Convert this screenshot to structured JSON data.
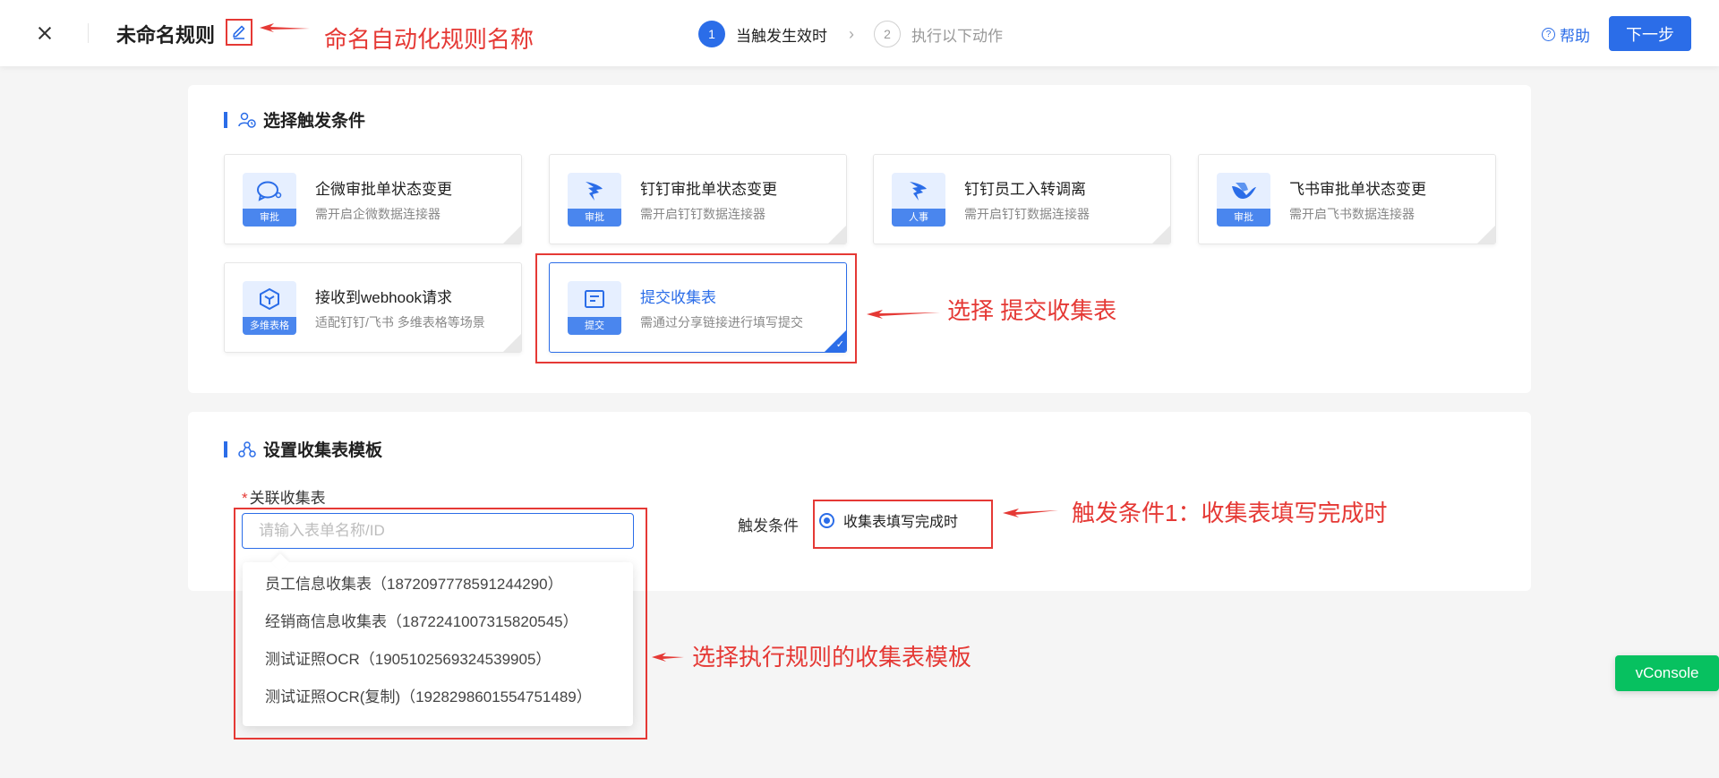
{
  "header": {
    "rule_name": "未命名规则",
    "steps": [
      {
        "num": "1",
        "label": "当触发生效时"
      },
      {
        "num": "2",
        "label": "执行以下动作"
      }
    ],
    "help_label": "帮助",
    "help_icon_glyph": "?",
    "next_label": "下一步"
  },
  "annotations": {
    "rename": "命名自动化规则名称",
    "select_form": "选择 提交收集表",
    "trigger1": "触发条件1：收集表填写完成时",
    "select_template": "选择执行规则的收集表模板"
  },
  "trigger_section": {
    "title": "选择触发条件",
    "cards": [
      {
        "title": "企微审批单状态变更",
        "desc": "需开启企微数据连接器",
        "tag": "审批",
        "icon": "wechat-work-icon"
      },
      {
        "title": "钉钉审批单状态变更",
        "desc": "需开启钉钉数据连接器",
        "tag": "审批",
        "icon": "dingtalk-icon"
      },
      {
        "title": "钉钉员工入转调离",
        "desc": "需开启钉钉数据连接器",
        "tag": "人事",
        "icon": "dingtalk-icon"
      },
      {
        "title": "飞书审批单状态变更",
        "desc": "需开启飞书数据连接器",
        "tag": "审批",
        "icon": "feishu-icon"
      },
      {
        "title": "接收到webhook请求",
        "desc": "适配钉钉/飞书 多维表格等场景",
        "tag": "多维表格",
        "icon": "cube-icon"
      },
      {
        "title": "提交收集表",
        "desc": "需通过分享链接进行填写提交",
        "tag": "提交",
        "icon": "form-icon",
        "selected": true
      }
    ]
  },
  "template_section": {
    "title": "设置收集表模板",
    "field_label": "关联收集表",
    "required_mark": "*",
    "search_placeholder": "请输入表单名称/ID",
    "trigger_label": "触发条件",
    "trigger_option": "收集表填写完成时",
    "dropdown_items": [
      "员工信息收集表（1872097778591244290）",
      "经销商信息收集表（1872241007315820545）",
      "测试证照OCR（1905102569324539905）",
      "测试证照OCR(复制)（1928298601554751489）"
    ]
  },
  "vconsole_label": "vConsole",
  "colors": {
    "accent": "#2b6de8",
    "annotation": "#e53935",
    "vconsole": "#07c160"
  }
}
